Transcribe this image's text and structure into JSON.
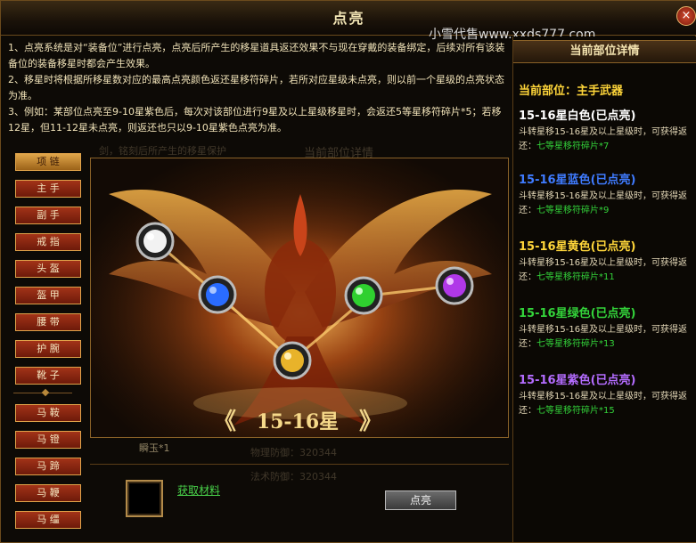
{
  "window": {
    "title": "点亮",
    "watermark": "小雪代售www.xxds777.com",
    "close_symbol": "×"
  },
  "description": [
    "1、点亮系统是对“装备位”进行点亮，点亮后所产生的移星道具返还效果不与现在穿戴的装备绑定，后续对所有该装备位的装备移星时都会产生效果。",
    "2、移星时将根据所移星数对应的最高点亮颜色返还星移符碎片，若所对应星级未点亮，则以前一个星级的点亮状态为准。",
    "3、例如：某部位点亮至9-10星紫色后，每次对该部位进行9星及以上星级移星时，会返还5等星移符碎片*5；若移12星，但11-12星未点亮，则返还也只以9-10星紫色点亮为准。"
  ],
  "sidebar": {
    "items": [
      {
        "label": "项 链",
        "active": true
      },
      {
        "label": "主 手",
        "active": false
      },
      {
        "label": "副 手",
        "active": false
      },
      {
        "label": "戒 指",
        "active": false
      },
      {
        "label": "头 盔",
        "active": false
      },
      {
        "label": "盔 甲",
        "active": false
      },
      {
        "label": "腰 带",
        "active": false
      },
      {
        "label": "护 腕",
        "active": false
      },
      {
        "label": "靴 子",
        "active": false
      },
      {
        "label": "马 鞍",
        "active": false
      },
      {
        "label": "马 镫",
        "active": false
      },
      {
        "label": "马 蹄",
        "active": false
      },
      {
        "label": "马 鞭",
        "active": false
      },
      {
        "label": "马 缰",
        "active": false
      }
    ]
  },
  "background_text": {
    "line1": "剑，铭刻后所产生的移星保护",
    "line2": "当前部位详情",
    "line3": "瞬玉*1",
    "line4": "物理防御：320344",
    "line5": "法术防御：320344"
  },
  "scene": {
    "stars_label": "15-16星",
    "left_arrow": "《",
    "right_arrow": "》",
    "orbs": [
      {
        "name": "white",
        "color": "#e8e8e8"
      },
      {
        "name": "blue",
        "color": "#2a6cff"
      },
      {
        "name": "gold",
        "color": "#e8b32a"
      },
      {
        "name": "green",
        "color": "#2fd02f"
      },
      {
        "name": "purple",
        "color": "#b038e8"
      }
    ]
  },
  "right_panel": {
    "header": "当前部位详情",
    "current_part": "当前部位：主手武器",
    "tiers": [
      {
        "title": "15-16星白色(已点亮)",
        "color": "#ffffff",
        "desc": "斗转星移15-16星及以上星级时，可获得返还：",
        "reward": "七等星移符碎片*7"
      },
      {
        "title": "15-16星蓝色(已点亮)",
        "color": "#3f7bff",
        "desc": "斗转星移15-16星及以上星级时，可获得返还：",
        "reward": "七等星移符碎片*9"
      },
      {
        "title": "15-16星黄色(已点亮)",
        "color": "#ffd63a",
        "desc": "斗转星移15-16星及以上星级时，可获得返还：",
        "reward": "七等星移符碎片*11"
      },
      {
        "title": "15-16星绿色(已点亮)",
        "color": "#33d33a",
        "desc": "斗转星移15-16星及以上星级时，可获得返还：",
        "reward": "七等星移符碎片*13"
      },
      {
        "title": "15-16星紫色(已点亮)",
        "color": "#b46cff",
        "desc": "斗转星移15-16星及以上星级时，可获得返还：",
        "reward": "七等星移符碎片*15"
      }
    ]
  },
  "bottom": {
    "get_material": "获取材料",
    "light_button": "点亮"
  }
}
